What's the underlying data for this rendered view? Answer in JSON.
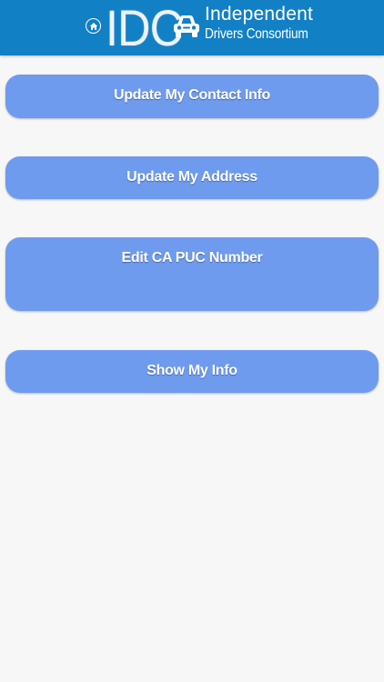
{
  "header": {
    "logo_text": "IDC",
    "tagline_line1": "Independent",
    "tagline_line2": "Drivers Consortium",
    "background_color": "#1280c5",
    "home_icon": "home-icon",
    "car_icon": "car-icon"
  },
  "menu": {
    "button_color": "#6f9bef",
    "items": [
      {
        "label": "Update My Contact Info"
      },
      {
        "label": "Update My Address"
      },
      {
        "label": "Edit CA PUC Number"
      },
      {
        "label": "Show My Info"
      }
    ]
  }
}
